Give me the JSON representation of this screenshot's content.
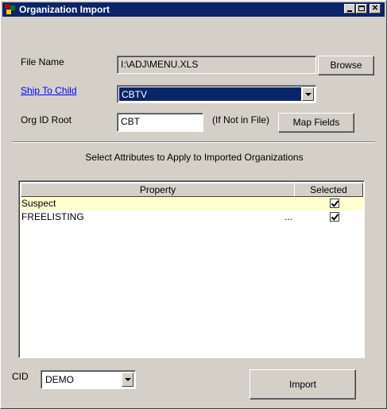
{
  "window": {
    "title": "Organization Import"
  },
  "form": {
    "file_name_label": "File Name",
    "file_name_value": "I:\\ADJ\\MENU.XLS",
    "browse_label": "Browse",
    "ship_to_child_label": "Ship To Child",
    "ship_to_child_value": "CBTV",
    "org_id_root_label": "Org ID Root",
    "org_id_root_value": "CBT",
    "org_id_hint": "(If Not in File)",
    "map_fields_label": "Map Fields"
  },
  "attributes": {
    "heading": "Select Attributes to Apply to Imported Organizations",
    "columns": [
      "Property",
      "Selected"
    ],
    "rows": [
      {
        "property": "Suspect",
        "extra": "",
        "selected": true
      },
      {
        "property": "FREELISTING",
        "extra": "...",
        "selected": true
      }
    ]
  },
  "footer": {
    "cid_label": "CID",
    "cid_value": "DEMO",
    "import_label": "Import"
  }
}
